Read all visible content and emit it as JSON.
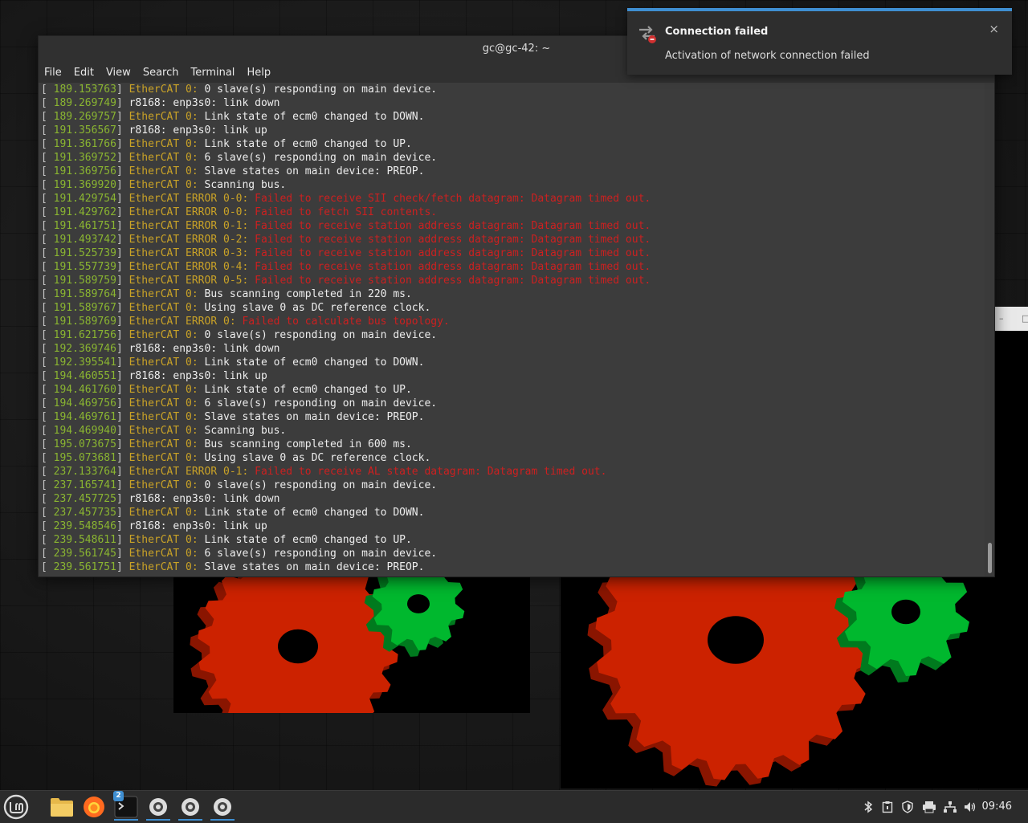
{
  "terminal": {
    "title": "gc@gc-42: ~",
    "menu": [
      "File",
      "Edit",
      "View",
      "Search",
      "Terminal",
      "Help"
    ],
    "lines": [
      {
        "ts": "189.153763",
        "sub": "EtherCAT 0:",
        "msg": " 0 slave(s) responding on main device.",
        "err": false
      },
      {
        "ts": "189.269749",
        "sub": "",
        "msg": "r8168: enp3s0: link down",
        "err": false
      },
      {
        "ts": "189.269757",
        "sub": "EtherCAT 0:",
        "msg": " Link state of ecm0 changed to DOWN.",
        "err": false
      },
      {
        "ts": "191.356567",
        "sub": "",
        "msg": "r8168: enp3s0: link up",
        "err": false
      },
      {
        "ts": "191.361766",
        "sub": "EtherCAT 0:",
        "msg": " Link state of ecm0 changed to UP.",
        "err": false
      },
      {
        "ts": "191.369752",
        "sub": "EtherCAT 0:",
        "msg": " 6 slave(s) responding on main device.",
        "err": false
      },
      {
        "ts": "191.369756",
        "sub": "EtherCAT 0:",
        "msg": " Slave states on main device: PREOP.",
        "err": false
      },
      {
        "ts": "191.369920",
        "sub": "EtherCAT 0:",
        "msg": " Scanning bus.",
        "err": false
      },
      {
        "ts": "191.429754",
        "sub": "EtherCAT ERROR 0-0:",
        "msg": " Failed to receive SII check/fetch datagram: Datagram timed out.",
        "err": true
      },
      {
        "ts": "191.429762",
        "sub": "EtherCAT ERROR 0-0:",
        "msg": " Failed to fetch SII contents.",
        "err": true
      },
      {
        "ts": "191.461751",
        "sub": "EtherCAT ERROR 0-1:",
        "msg": " Failed to receive station address datagram: Datagram timed out.",
        "err": true
      },
      {
        "ts": "191.493742",
        "sub": "EtherCAT ERROR 0-2:",
        "msg": " Failed to receive station address datagram: Datagram timed out.",
        "err": true
      },
      {
        "ts": "191.525739",
        "sub": "EtherCAT ERROR 0-3:",
        "msg": " Failed to receive station address datagram: Datagram timed out.",
        "err": true
      },
      {
        "ts": "191.557739",
        "sub": "EtherCAT ERROR 0-4:",
        "msg": " Failed to receive station address datagram: Datagram timed out.",
        "err": true
      },
      {
        "ts": "191.589759",
        "sub": "EtherCAT ERROR 0-5:",
        "msg": " Failed to receive station address datagram: Datagram timed out.",
        "err": true
      },
      {
        "ts": "191.589764",
        "sub": "EtherCAT 0:",
        "msg": " Bus scanning completed in 220 ms.",
        "err": false
      },
      {
        "ts": "191.589767",
        "sub": "EtherCAT 0:",
        "msg": " Using slave 0 as DC reference clock.",
        "err": false
      },
      {
        "ts": "191.589769",
        "sub": "EtherCAT ERROR 0:",
        "msg": " Failed to calculate bus topology.",
        "err": true
      },
      {
        "ts": "191.621756",
        "sub": "EtherCAT 0:",
        "msg": " 0 slave(s) responding on main device.",
        "err": false
      },
      {
        "ts": "192.369746",
        "sub": "",
        "msg": "r8168: enp3s0: link down",
        "err": false
      },
      {
        "ts": "192.395541",
        "sub": "EtherCAT 0:",
        "msg": " Link state of ecm0 changed to DOWN.",
        "err": false
      },
      {
        "ts": "194.460551",
        "sub": "",
        "msg": "r8168: enp3s0: link up",
        "err": false
      },
      {
        "ts": "194.461760",
        "sub": "EtherCAT 0:",
        "msg": " Link state of ecm0 changed to UP.",
        "err": false
      },
      {
        "ts": "194.469756",
        "sub": "EtherCAT 0:",
        "msg": " 6 slave(s) responding on main device.",
        "err": false
      },
      {
        "ts": "194.469761",
        "sub": "EtherCAT 0:",
        "msg": " Slave states on main device: PREOP.",
        "err": false
      },
      {
        "ts": "194.469940",
        "sub": "EtherCAT 0:",
        "msg": " Scanning bus.",
        "err": false
      },
      {
        "ts": "195.073675",
        "sub": "EtherCAT 0:",
        "msg": " Bus scanning completed in 600 ms.",
        "err": false
      },
      {
        "ts": "195.073681",
        "sub": "EtherCAT 0:",
        "msg": " Using slave 0 as DC reference clock.",
        "err": false
      },
      {
        "ts": "237.133764",
        "sub": "EtherCAT ERROR 0-1:",
        "msg": " Failed to receive AL state datagram: Datagram timed out.",
        "err": true
      },
      {
        "ts": "237.165741",
        "sub": "EtherCAT 0:",
        "msg": " 0 slave(s) responding on main device.",
        "err": false
      },
      {
        "ts": "237.457725",
        "sub": "",
        "msg": "r8168: enp3s0: link down",
        "err": false
      },
      {
        "ts": "237.457735",
        "sub": "EtherCAT 0:",
        "msg": " Link state of ecm0 changed to DOWN.",
        "err": false
      },
      {
        "ts": "239.548546",
        "sub": "",
        "msg": "r8168: enp3s0: link up",
        "err": false
      },
      {
        "ts": "239.548611",
        "sub": "EtherCAT 0:",
        "msg": " Link state of ecm0 changed to UP.",
        "err": false
      },
      {
        "ts": "239.561745",
        "sub": "EtherCAT 0:",
        "msg": " 6 slave(s) responding on main device.",
        "err": false
      },
      {
        "ts": "239.561751",
        "sub": "EtherCAT 0:",
        "msg": " Slave states on main device: PREOP.",
        "err": false
      }
    ]
  },
  "notification": {
    "title": "Connection failed",
    "body": "Activation of network connection failed",
    "close": "×"
  },
  "taskbar": {
    "terminal_badge": "2",
    "clock": "09:46"
  },
  "colors": {
    "accent": "#3f8fd2",
    "timestamp": "#8ab531",
    "subsystem": "#c9a227",
    "error": "#cc2020",
    "gear_red": "#cc2200",
    "gear_green": "#00b82e"
  }
}
